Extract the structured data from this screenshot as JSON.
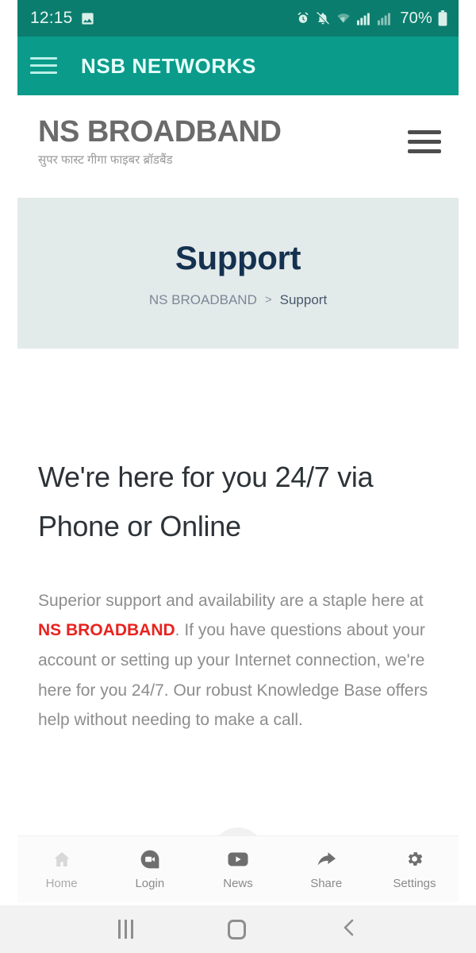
{
  "statusbar": {
    "time": "12:15",
    "battery_percent": "70%",
    "icons": [
      "image-icon",
      "alarm-icon",
      "mute-bell-icon",
      "wifi-icon",
      "signal-bars-icon",
      "signal-bars-secondary-icon",
      "battery-icon"
    ]
  },
  "appbar": {
    "title": "NSB NETWORKS",
    "menu_icon": "hamburger-menu-icon"
  },
  "siteheader": {
    "brand": "NS BROADBAND",
    "tagline": "सुपर फास्ट गीगा फाइबर ब्रॉडबैंड",
    "menu_icon": "hamburger-menu-icon"
  },
  "hero": {
    "title": "Support",
    "breadcrumb": {
      "root": "NS BROADBAND",
      "separator": ">",
      "current": "Support"
    }
  },
  "main": {
    "headline": "We're here for you 24/7 via Phone or Online",
    "paragraph": {
      "before": "Superior support and availability are a staple here at ",
      "highlight": "NS BROADBAND",
      "after": ". If you have questions about your account or setting up your Internet connection, we're here for you 24/7. Our robust Knowledge Base offers help without needing to make a call."
    }
  },
  "tabbar": {
    "items": [
      {
        "label": "Home",
        "icon": "home-icon"
      },
      {
        "label": "Login",
        "icon": "video-call-icon"
      },
      {
        "label": "News",
        "icon": "play-button-icon"
      },
      {
        "label": "Share",
        "icon": "share-arrow-icon"
      },
      {
        "label": "Settings",
        "icon": "gear-icon"
      }
    ]
  },
  "navbar": {
    "recents": "recents-icon",
    "home": "home-square-icon",
    "back": "back-chevron-icon"
  },
  "colors": {
    "statusbar_teal": "#0b7d6e",
    "appbar_teal": "#0a9b8a",
    "hero_grey": "#e3eaea",
    "hero_title_navy": "#14314f",
    "accent_red": "#e8231f",
    "body_grey": "#8d8d8d"
  }
}
